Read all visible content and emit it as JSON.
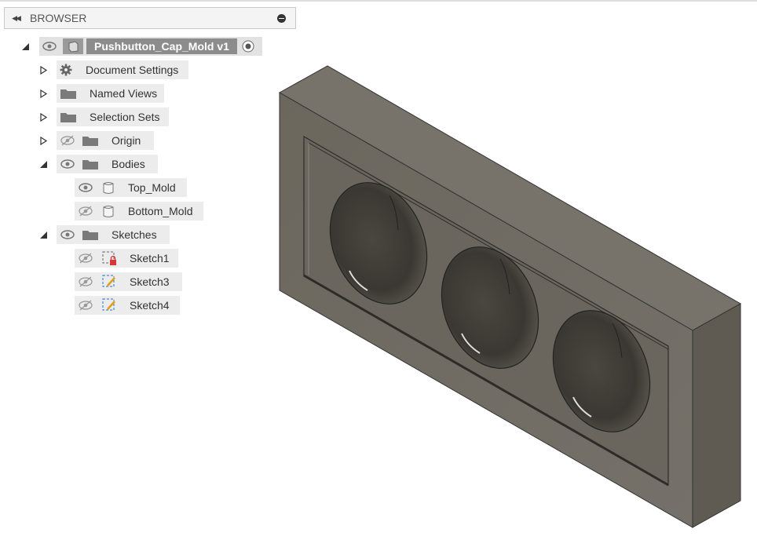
{
  "browser": {
    "title": "BROWSER",
    "root": {
      "label": "Pushbutton_Cap_Mold v1"
    },
    "items": [
      {
        "label": "Document Settings",
        "icon": "gear-icon"
      },
      {
        "label": "Named Views",
        "icon": "folder-icon"
      },
      {
        "label": "Selection Sets",
        "icon": "folder-icon"
      },
      {
        "label": "Origin",
        "icon": "folder-icon",
        "visible": false
      },
      {
        "label": "Bodies",
        "icon": "folder-icon",
        "visible": true
      },
      {
        "label": "Top_Mold",
        "icon": "body-icon",
        "visible": true
      },
      {
        "label": "Bottom_Mold",
        "icon": "body-icon",
        "visible": false
      },
      {
        "label": "Sketches",
        "icon": "folder-icon",
        "visible": true
      },
      {
        "label": "Sketch1",
        "icon": "sketch-locked-icon",
        "visible": false
      },
      {
        "label": "Sketch3",
        "icon": "sketch-icon",
        "visible": false
      },
      {
        "label": "Sketch4",
        "icon": "sketch-icon",
        "visible": false
      }
    ]
  },
  "colors": {
    "panel_bg": "#ececec",
    "root_label_bg": "#8c8c8c",
    "model_face_front": "#6e6a60",
    "model_face_top": "#7b766b",
    "model_face_side": "#5f5b52"
  }
}
